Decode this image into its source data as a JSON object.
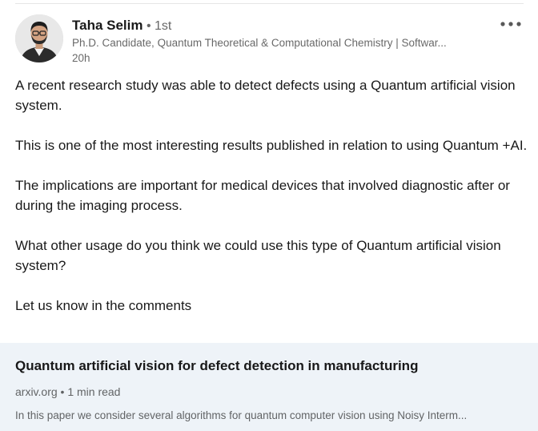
{
  "post": {
    "author": {
      "name": "Taha Selim",
      "degree": " • 1st",
      "headline": "Ph.D. Candidate, Quantum Theoretical & Computational Chemistry | Softwar...",
      "timestamp": "20h",
      "avatar_icon": "profile-photo"
    },
    "menu_icon": "more-horizontal-icon",
    "paragraphs": [
      "A recent research study was able to detect defects using a Quantum artificial vision system.",
      "This is one of the most interesting results published in relation to using Quantum +AI.",
      "The implications are important for medical devices that involved diagnostic after or during the imaging process.",
      "What other usage do you think we could use this type of Quantum artificial vision system?",
      "Let us know in the comments"
    ]
  },
  "article": {
    "title": "Quantum artificial vision for defect detection in manufacturing",
    "meta": "arxiv.org • 1 min read",
    "description": "In this paper we consider several algorithms for quantum computer vision using Noisy Interm..."
  },
  "colors": {
    "card_background": "#eef3f8",
    "primary_text": "#1f1f1f",
    "secondary_text": "#666666"
  }
}
